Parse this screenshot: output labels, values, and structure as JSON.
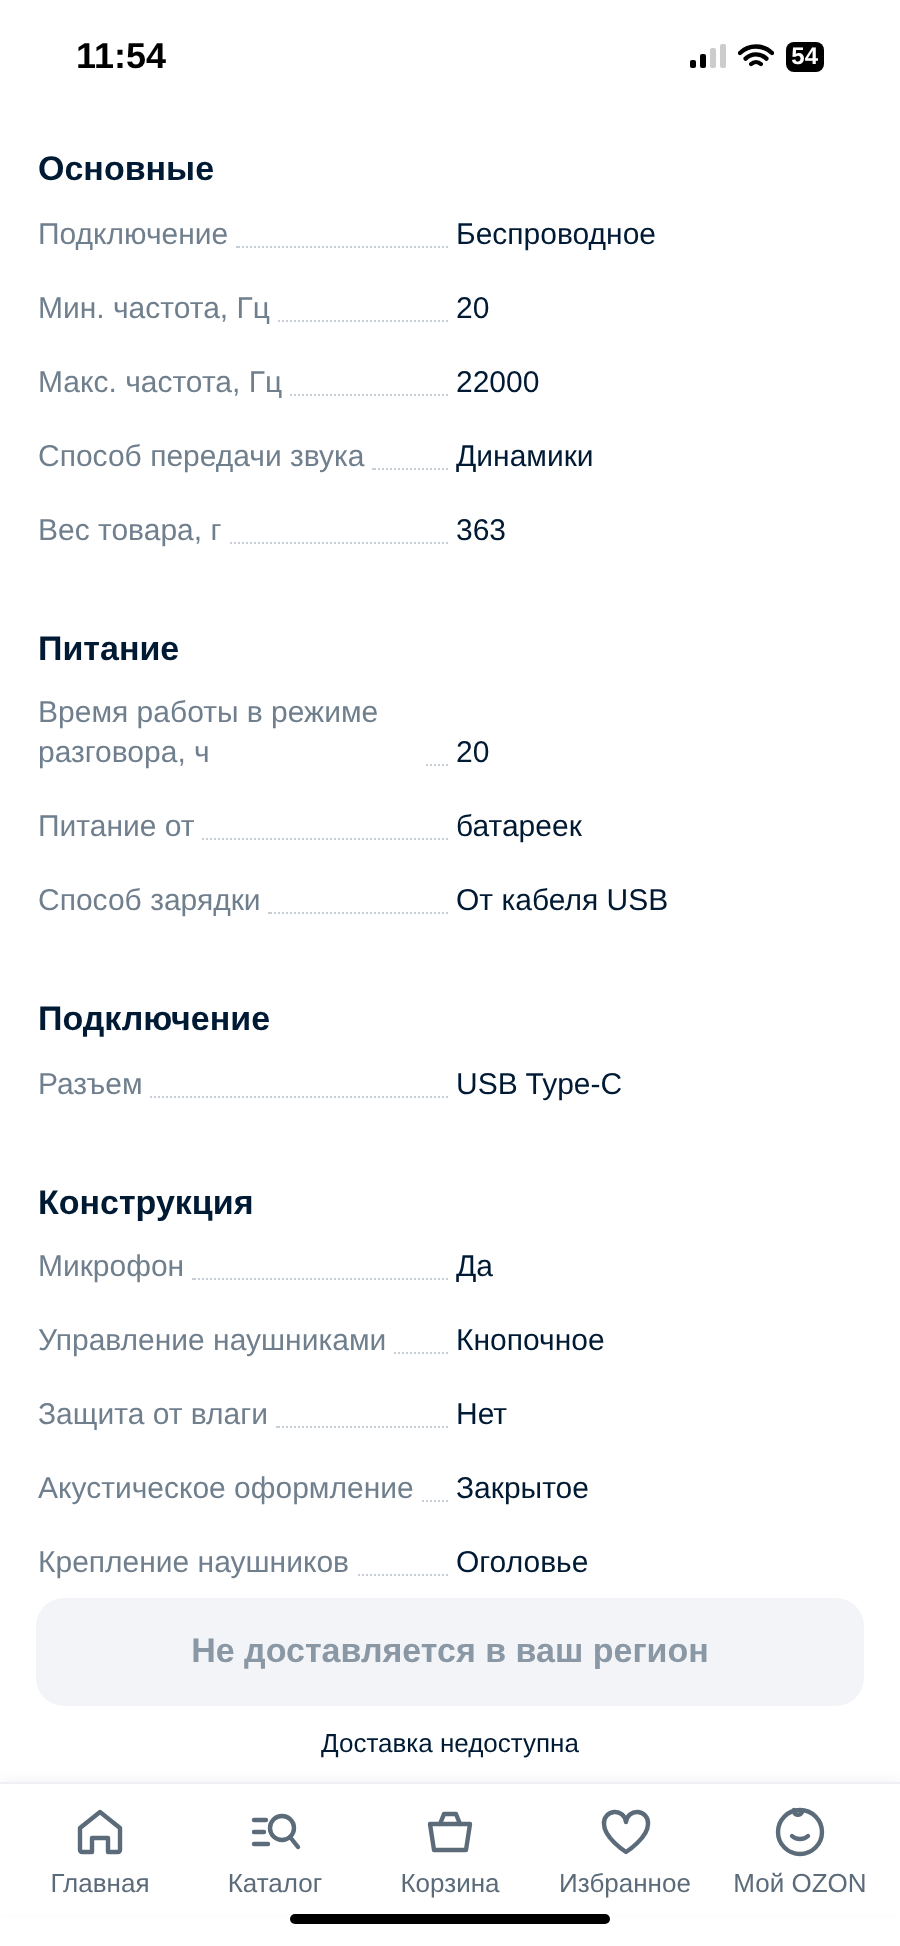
{
  "status_bar": {
    "time": "11:54",
    "battery": "54"
  },
  "sections": [
    {
      "title": "Основные",
      "rows": [
        {
          "label": "Подключение",
          "value": "Беспроводное"
        },
        {
          "label": "Мин. частота, Гц",
          "value": "20"
        },
        {
          "label": "Макс. частота, Гц",
          "value": "22000"
        },
        {
          "label": "Способ передачи звука",
          "value": "Динамики"
        },
        {
          "label": "Вес товара, г",
          "value": "363"
        }
      ]
    },
    {
      "title": "Питание",
      "rows": [
        {
          "label": "Время работы в режиме разговора, ч",
          "value": "20"
        },
        {
          "label": "Питание от",
          "value": "батареек"
        },
        {
          "label": "Способ зарядки",
          "value": "От кабеля USB"
        }
      ]
    },
    {
      "title": "Подключение",
      "rows": [
        {
          "label": "Разъем",
          "value": "USB Type-C"
        }
      ]
    },
    {
      "title": "Конструкция",
      "rows": [
        {
          "label": "Микрофон",
          "value": "Да"
        },
        {
          "label": "Управление наушниками",
          "value": "Кнопочное"
        },
        {
          "label": "Защита от влаги",
          "value": "Нет"
        },
        {
          "label": "Акустическое оформление",
          "value": "Закрытое"
        },
        {
          "label": "Крепление наушников",
          "value": "Оголовье"
        }
      ]
    }
  ],
  "delivery": {
    "button": "Не доставляется в ваш регион",
    "note": "Доставка недоступна"
  },
  "tab_bar": [
    {
      "kind": "home",
      "label": "Главная"
    },
    {
      "kind": "catalog",
      "label": "Каталог"
    },
    {
      "kind": "cart",
      "label": "Корзина"
    },
    {
      "kind": "favorites",
      "label": "Избранное"
    },
    {
      "kind": "profile",
      "label": "Мой OZON"
    }
  ]
}
